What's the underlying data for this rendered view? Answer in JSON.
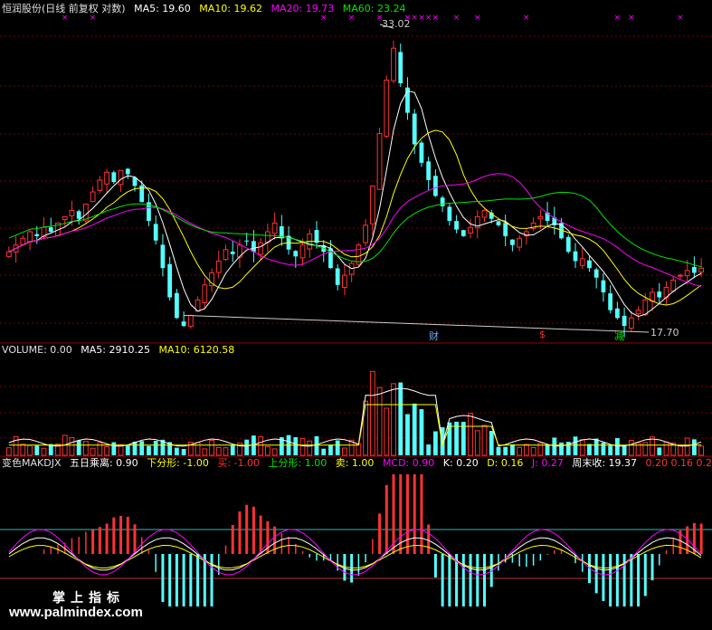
{
  "colors": {
    "up": "#ff3232",
    "down": "#54ffff",
    "ma5": "#ffffff",
    "ma10": "#ffff00",
    "ma20": "#ff00ff",
    "ma60": "#00e600",
    "grid": "#7a0000",
    "axis": "#a00000"
  },
  "price_header": {
    "name": "恒润股份(日线 前复权 对数)",
    "ma5": "MA5: 19.60",
    "ma10": "MA10: 19.62",
    "ma20": "MA20: 19.73",
    "ma60": "MA60: 23.24"
  },
  "price_annotations": {
    "high": "33.02",
    "low": "17.70",
    "badges": [
      {
        "text": "财",
        "color": "#6fa8ff"
      },
      {
        "text": "$",
        "color": "#ff3232"
      },
      {
        "text": "减",
        "color": "#00e600"
      }
    ]
  },
  "volume_header": {
    "name": "VOLUME: 0.00",
    "ma5": "MA5: 2910.25",
    "ma10": "MA10: 6120.58"
  },
  "indicator_header": {
    "name": "变色MAKDJX",
    "wuri": "五日乘离: 0.90",
    "xfx": "下分形: -1.00",
    "mai": "买: -1.00",
    "sfx": "上分形: 1.00",
    "mai2": "卖: 1.00",
    "mcd": "MCD: 0.90",
    "k": "K: 0.20",
    "d": "D: 0.16",
    "j": "J: 0.27",
    "zms": "周末收: 19.37",
    "extra": "0.20   0.16   0.2"
  },
  "watermark": {
    "cn": "掌上指标",
    "url": "www.palmindex.com"
  },
  "chart_data": [
    {
      "type": "candlestick",
      "title": "恒润股份(日线 前复权 对数)",
      "yscale": "log",
      "high": 33.02,
      "low": 17.7,
      "ma_last": {
        "MA5": 19.6,
        "MA10": 19.62,
        "MA20": 19.73,
        "MA60": 23.24
      },
      "closes": [
        20.3,
        20.6,
        20.9,
        21.2,
        21.0,
        21.4,
        21.2,
        21.6,
        21.9,
        22.2,
        21.8,
        22.5,
        23.1,
        23.7,
        24.1,
        23.6,
        24.2,
        24.0,
        23.4,
        22.6,
        21.7,
        20.8,
        19.6,
        18.4,
        17.6,
        17.3,
        17.7,
        18.3,
        18.9,
        19.4,
        19.9,
        20.4,
        20.2,
        20.6,
        20.8,
        20.3,
        20.7,
        21.2,
        21.6,
        20.9,
        20.4,
        20.1,
        20.6,
        21.1,
        20.7,
        20.3,
        19.6,
        18.9,
        19.3,
        19.8,
        20.6,
        21.5,
        23.4,
        26.2,
        29.4,
        31.5,
        29.2,
        27.4,
        25.6,
        24.6,
        23.7,
        22.9,
        22.4,
        21.7,
        21.3,
        21.0,
        21.4,
        21.9,
        22.2,
        21.8,
        21.5,
        21.0,
        20.6,
        20.9,
        21.2,
        21.6,
        21.9,
        21.7,
        21.5,
        20.9,
        20.3,
        19.9,
        20.0,
        19.6,
        19.2,
        18.6,
        17.9,
        17.6,
        17.3,
        17.6,
        17.9,
        18.3,
        18.6,
        18.4,
        18.8,
        19.1,
        19.3,
        19.5,
        19.4,
        19.6
      ]
    },
    {
      "type": "bar",
      "title": "VOLUME",
      "series": [
        {
          "name": "MA5",
          "value": 2910.25
        },
        {
          "name": "MA10",
          "value": 6120.58
        }
      ]
    },
    {
      "type": "line",
      "title": "变色MAKDJX",
      "values": {
        "K": 0.2,
        "D": 0.16,
        "J": 0.27,
        "MCD": 0.9,
        "五日乘离": 0.9
      }
    }
  ]
}
